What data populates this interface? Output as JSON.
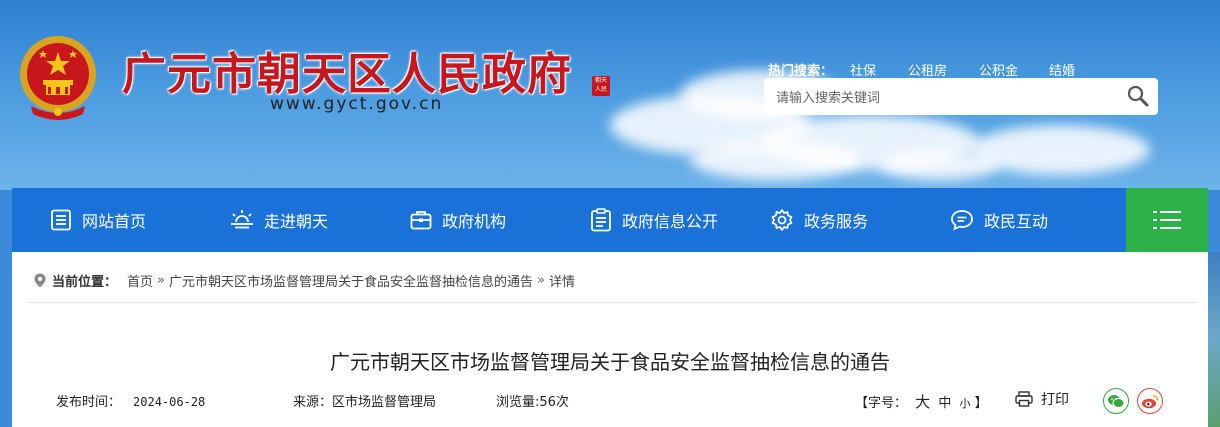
{
  "header": {
    "site_title": "广元市朝天区人民政府",
    "site_url": "www.gyct.gov.cn",
    "seal_text": "朝天·人民"
  },
  "hot_search": {
    "label": "热门搜索：",
    "keywords": [
      "社保",
      "公租房",
      "公积金",
      "结婚"
    ]
  },
  "search": {
    "placeholder": "请输入搜索关键词",
    "value": ""
  },
  "nav": {
    "items": [
      {
        "label": "网站首页",
        "icon": "home-icon"
      },
      {
        "label": "走进朝天",
        "icon": "sunrise-icon"
      },
      {
        "label": "政府机构",
        "icon": "briefcase-icon"
      },
      {
        "label": "政府信息公开",
        "icon": "clipboard-icon"
      },
      {
        "label": "政务服务",
        "icon": "gear-icon"
      },
      {
        "label": "政民互动",
        "icon": "chat-icon"
      }
    ],
    "menu_icon": "menu-icon"
  },
  "breadcrumb": {
    "label": "当前位置：",
    "items": [
      "首页",
      "广元市朝天区市场监督管理局关于食品安全监督抽检信息的通告",
      "详情"
    ],
    "separator": "»"
  },
  "article": {
    "title": "广元市朝天区市场监督管理局关于食品安全监督抽检信息的通告",
    "publish_label": "发布时间：",
    "publish_date": "2024-06-28",
    "source": "来源：区市场监督管理局",
    "views": "浏览量:56次",
    "font_size_prefix": "【字号：",
    "font_sizes": [
      "大",
      "中",
      "小"
    ],
    "font_size_suffix": "】",
    "print_label": "打印"
  },
  "colors": {
    "nav_bg": "#1a72d8",
    "menu_bg": "#2db24a",
    "title_red": "#c8161d",
    "wechat_green": "#3aa640",
    "weibo_red": "#e0463a"
  }
}
